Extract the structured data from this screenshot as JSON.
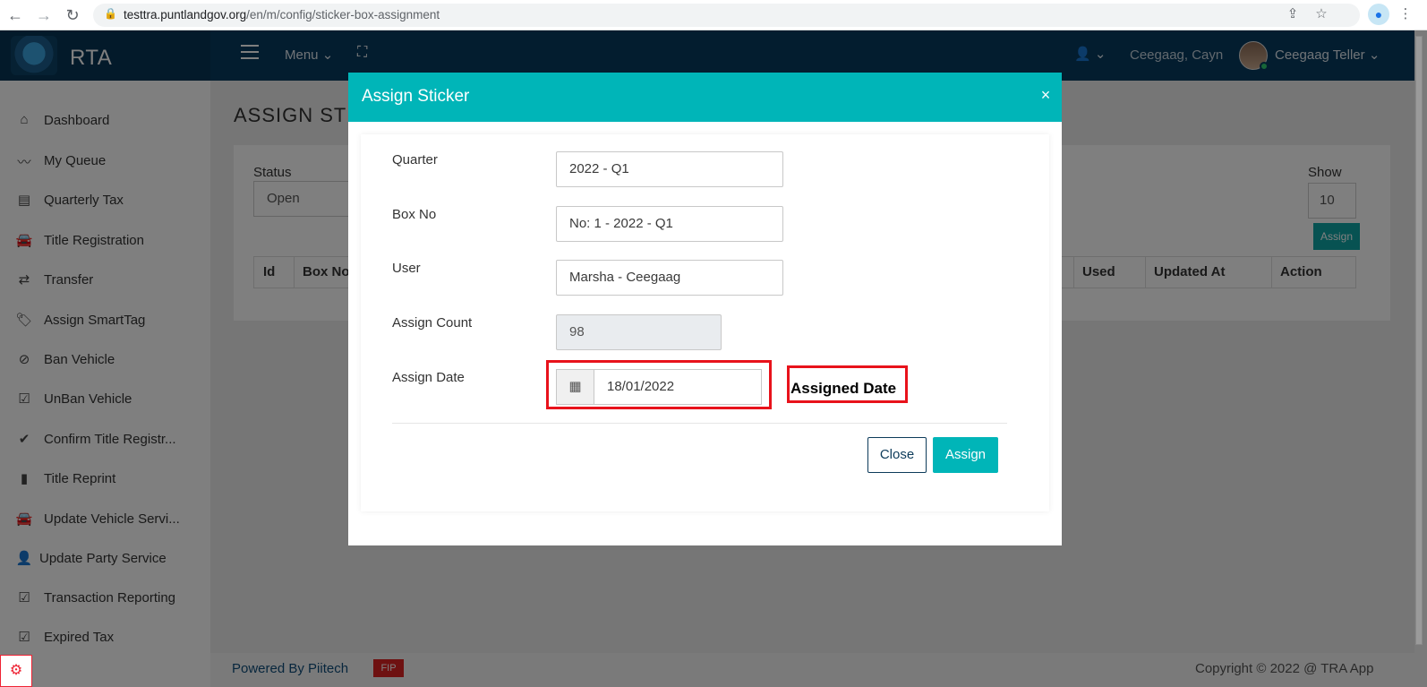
{
  "browser": {
    "url_host": "testtra.puntlandgov.org",
    "url_path": "/en/m/config/sticker-box-assignment"
  },
  "header": {
    "app_name": "RTA",
    "menu_label": "Menu",
    "user_short": "Ceegaag, Cayn",
    "user_role": "Ceegaag Teller"
  },
  "sidebar": {
    "items": [
      {
        "label": "Dashboard",
        "icon": "home-icon"
      },
      {
        "label": "My Queue",
        "icon": "trend-icon"
      },
      {
        "label": "Quarterly Tax",
        "icon": "list-icon"
      },
      {
        "label": "Title Registration",
        "icon": "car-icon"
      },
      {
        "label": "Transfer",
        "icon": "exchange-icon"
      },
      {
        "label": "Assign SmartTag",
        "icon": "tags-icon"
      },
      {
        "label": "Ban Vehicle",
        "icon": "ban-icon"
      },
      {
        "label": "UnBan Vehicle",
        "icon": "check-square-icon"
      },
      {
        "label": "Confirm Title Registr...",
        "icon": "check-icon"
      },
      {
        "label": "Title Reprint",
        "icon": "file-icon"
      },
      {
        "label": "Update Vehicle Servi...",
        "icon": "car-icon"
      },
      {
        "label": "Update Party Service",
        "icon": "user-icon"
      },
      {
        "label": "Transaction Reporting",
        "icon": "check-square-icon"
      },
      {
        "label": "Expired Tax",
        "icon": "check-square-icon"
      }
    ]
  },
  "page": {
    "title": "ASSIGN STI",
    "status_label": "Status",
    "status_value": "Open",
    "show_label": "Show",
    "show_value": "10",
    "assign_button": "Assign",
    "columns": [
      "Id",
      "Box No",
      "Used",
      "Updated At",
      "Action"
    ]
  },
  "footer": {
    "powered_by": "Powered By Piitech",
    "badge": "FIP",
    "copyright": "Copyright © 2022 @ TRA App"
  },
  "modal": {
    "title": "Assign Sticker",
    "close_symbol": "×",
    "fields": {
      "quarter_label": "Quarter",
      "quarter_value": "2022 - Q1",
      "box_label": "Box No",
      "box_value": "No: 1 - 2022 - Q1",
      "user_label": "User",
      "user_value": "Marsha - Ceegaag",
      "count_label": "Assign Count",
      "count_value": "98",
      "date_label": "Assign Date",
      "date_value": "18/01/2022"
    },
    "annotation": "Assigned Date",
    "close_button": "Close",
    "assign_button": "Assign"
  },
  "colors": {
    "accent": "#00b5b8",
    "header": "#073b5e",
    "annotation_border": "#e8121b"
  }
}
